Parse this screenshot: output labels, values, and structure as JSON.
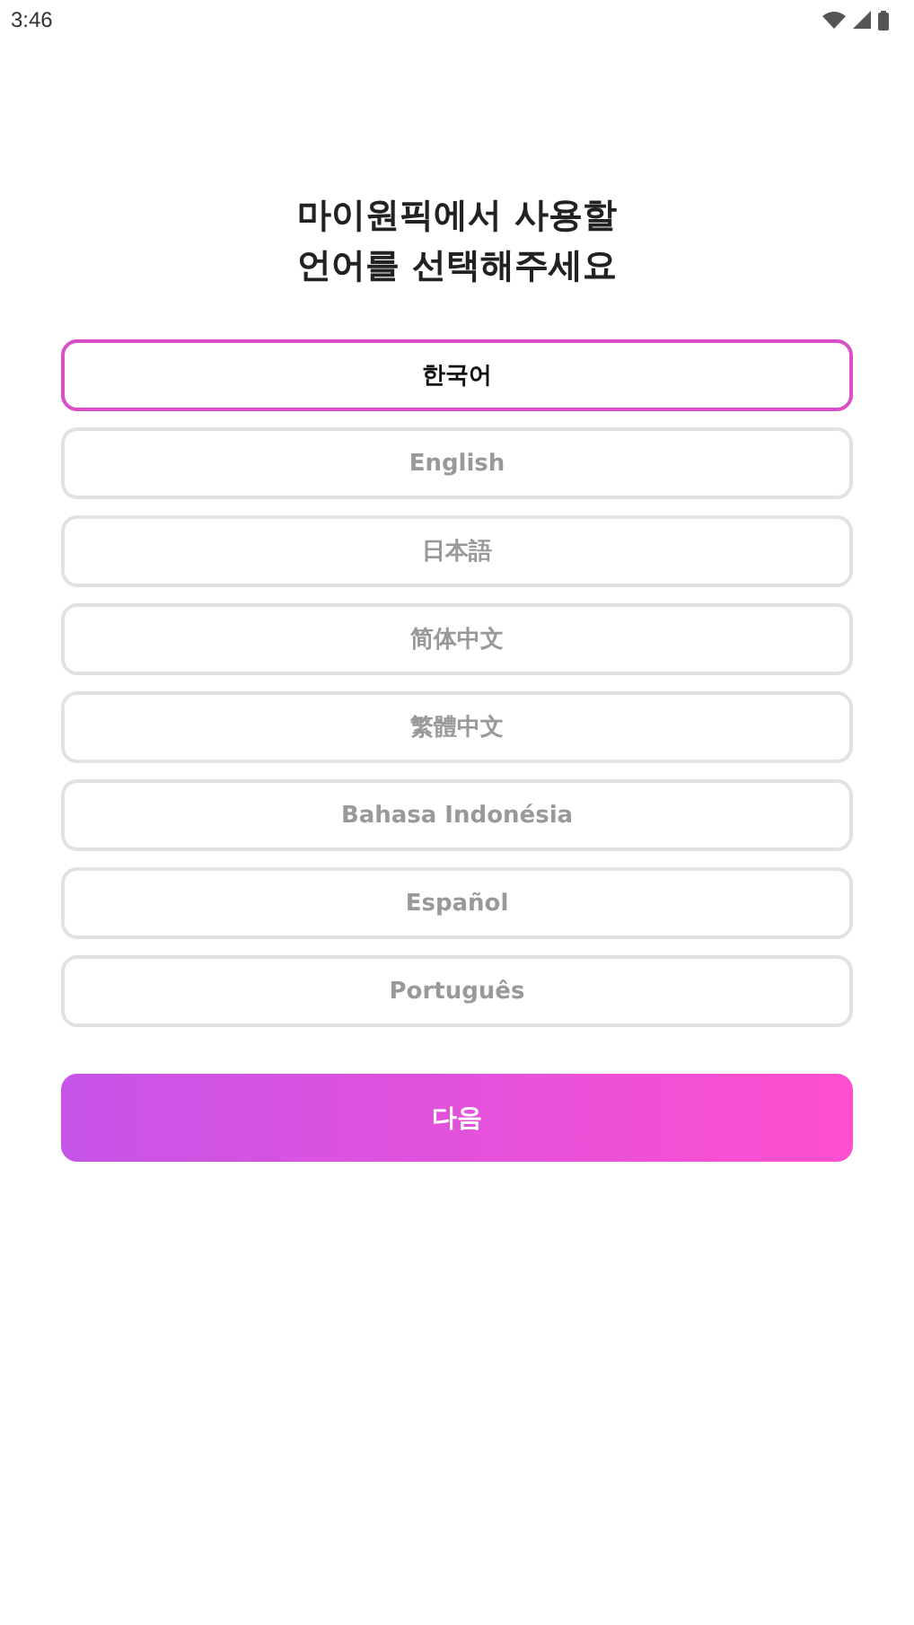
{
  "status_bar": {
    "time": "3:46"
  },
  "title_lines": [
    "마이원픽에서 사용할",
    "언어를 선택해주세요"
  ],
  "languages": [
    {
      "label": "한국어",
      "selected": true
    },
    {
      "label": "English",
      "selected": false
    },
    {
      "label": "日本語",
      "selected": false
    },
    {
      "label": "简体中文",
      "selected": false
    },
    {
      "label": "繁體中文",
      "selected": false
    },
    {
      "label": "Bahasa Indonésia",
      "selected": false
    },
    {
      "label": "Español",
      "selected": false
    },
    {
      "label": "Português",
      "selected": false
    }
  ],
  "next_button": {
    "label": "다음"
  }
}
